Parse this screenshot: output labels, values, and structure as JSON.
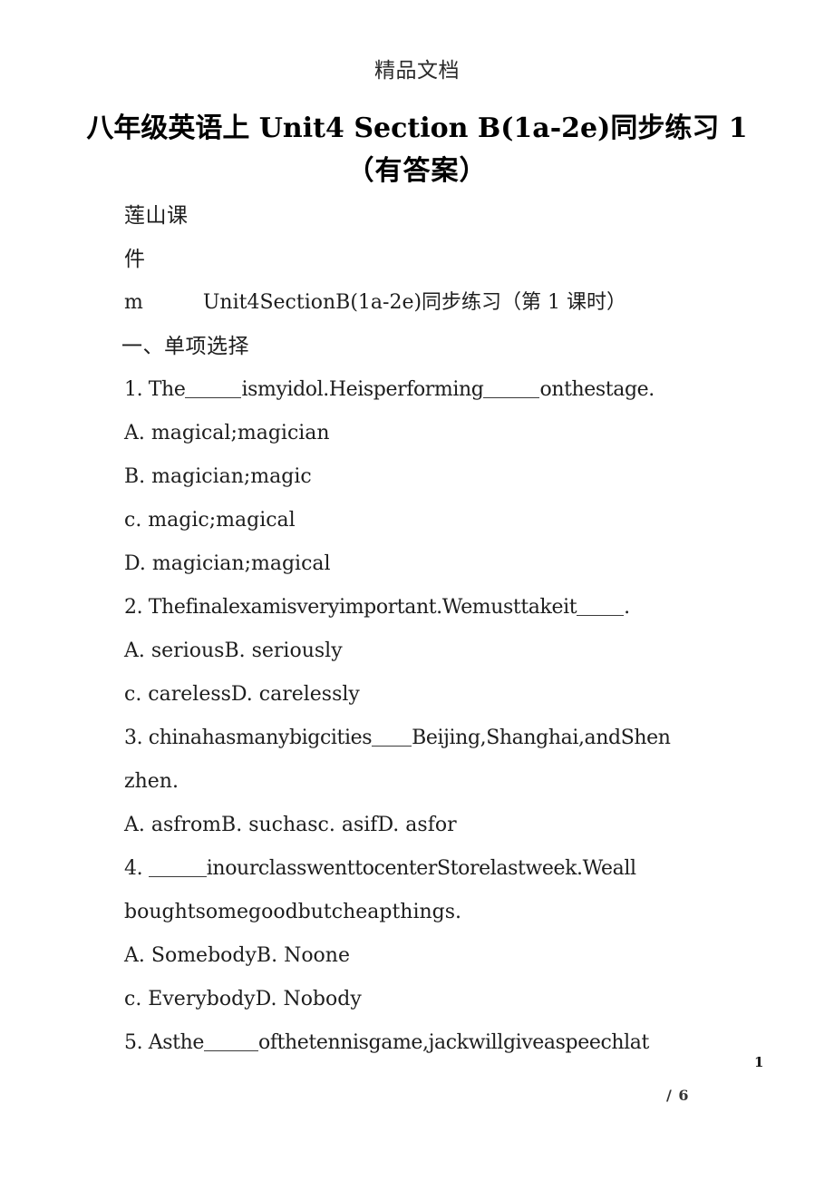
{
  "header": {
    "watermark": "精品文档"
  },
  "title": {
    "line1": "八年级英语上 Unit4 Section B(1a-2e)同步练习 1",
    "line2": "（有答案）"
  },
  "source": {
    "line1": "莲山课",
    "line2": "件",
    "prefix": "m",
    "subtitle": "Unit4SectionB(1a-2e)同步练习（第 1 课时）"
  },
  "section": {
    "heading": "一、单项选择"
  },
  "questions": [
    {
      "stem_pre": "1. The",
      "stem_mid": "ismyidol.Heisperforming",
      "stem_post": "onthestage.",
      "options": [
        "A. magical;magician",
        "B. magician;magic",
        "c. magic;magical",
        "D. magician;magical"
      ]
    },
    {
      "stem_pre": "2. Thefinalexamisveryimportant.Wemusttakeit",
      "stem_post": ".",
      "options": [
        "A. seriousB. seriously",
        "c. carelessD. carelessly"
      ]
    },
    {
      "stem_pre": "3. chinahasmanybigcities",
      "stem_post": "Beijing,Shanghai,andShen",
      "stem_wrap": "zhen.",
      "options": [
        "A. asfromB. suchasc. asifD. asfor"
      ]
    },
    {
      "stem_pre": "4. ",
      "stem_post": "inourclasswenttocenterStorelastweek.Weall",
      "stem_wrap": "boughtsomegoodbutcheapthings.",
      "options": [
        "A. SomebodyB. Noone",
        "c. EverybodyD. Nobody"
      ]
    },
    {
      "stem_pre": "5. Asthe",
      "stem_post": "ofthetennisgame,jackwillgiveaspeechlat",
      "options": []
    }
  ],
  "footer": {
    "page_number": "1",
    "page_total": "/ 6"
  }
}
